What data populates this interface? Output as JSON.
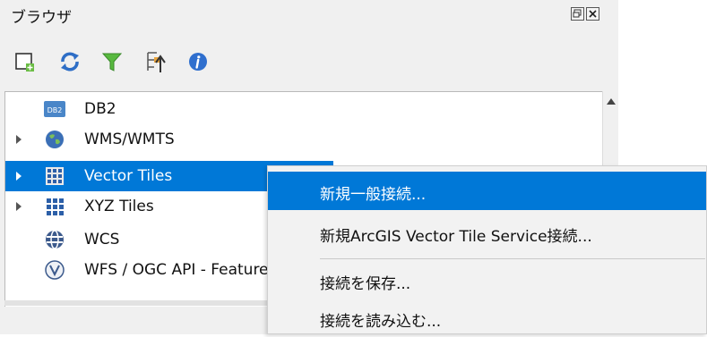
{
  "panel": {
    "title": "ブラウザ",
    "float_button_icon": "float-icon",
    "close_button_icon": "close-icon"
  },
  "toolbar": {
    "buttons": [
      {
        "name": "add-layer",
        "icon": "add-layer-icon"
      },
      {
        "name": "refresh",
        "icon": "refresh-icon"
      },
      {
        "name": "filter",
        "icon": "filter-icon"
      },
      {
        "name": "collapse-all",
        "icon": "collapse-all-icon"
      },
      {
        "name": "info",
        "icon": "info-icon"
      }
    ]
  },
  "tree": {
    "items": [
      {
        "label": "DB2",
        "icon": "db2-icon",
        "icon_text": "DB2",
        "expandable": false
      },
      {
        "label": "WMS/WMTS",
        "icon": "globe-icon",
        "expandable": true
      },
      {
        "label": "Vector Tiles",
        "icon": "vector-tiles-icon",
        "expandable": true,
        "selected": true
      },
      {
        "label": "XYZ Tiles",
        "icon": "xyz-tiles-icon",
        "expandable": true
      },
      {
        "label": "WCS",
        "icon": "wcs-icon",
        "expandable": false
      },
      {
        "label": "WFS / OGC API - Features",
        "icon": "wfs-icon",
        "expandable": false
      }
    ]
  },
  "context_menu": {
    "items": [
      {
        "label": "新規一般接続...",
        "highlighted": true
      },
      {
        "label": "新規ArcGIS Vector Tile Service接続..."
      },
      {
        "label": "接続を保存..."
      },
      {
        "label": "接続を読み込む..."
      }
    ]
  },
  "colors": {
    "selection": "#0078d7",
    "panel_bg": "#f0f0f0",
    "menu_bg": "#f2f2f2"
  }
}
